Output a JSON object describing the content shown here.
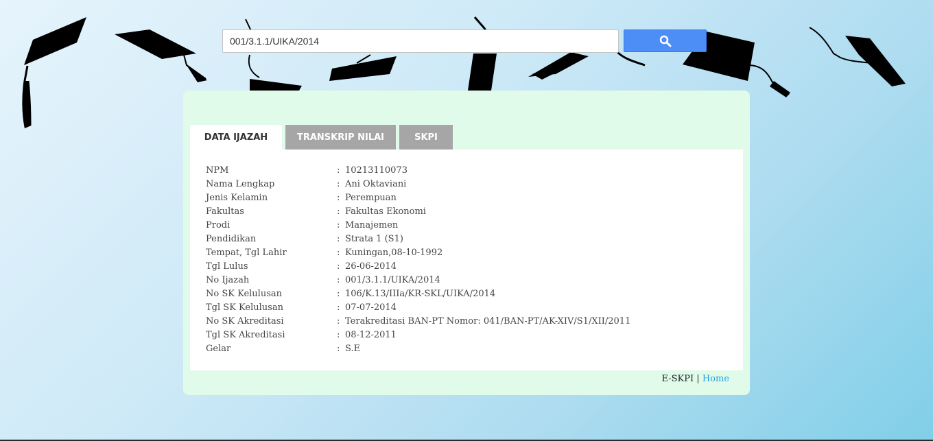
{
  "search": {
    "value": "001/3.1.1/UIKA/2014",
    "button_icon": "search-icon"
  },
  "tabs": [
    {
      "label": "DATA IJAZAH",
      "active": true
    },
    {
      "label": "TRANSKRIP NILAI",
      "active": false
    },
    {
      "label": "SKPI",
      "active": false
    }
  ],
  "separator": ":",
  "fields": [
    {
      "label": "NPM",
      "value": "10213110073"
    },
    {
      "label": "Nama Lengkap",
      "value": "Ani Oktaviani"
    },
    {
      "label": "Jenis Kelamin",
      "value": "Perempuan"
    },
    {
      "label": "Fakultas",
      "value": "Fakultas Ekonomi"
    },
    {
      "label": "Prodi",
      "value": "Manajemen"
    },
    {
      "label": "Pendidikan",
      "value": "Strata 1 (S1)"
    },
    {
      "label": "Tempat, Tgl Lahir",
      "value": "Kuningan,08-10-1992"
    },
    {
      "label": "Tgl Lulus",
      "value": "26-06-2014"
    },
    {
      "label": "No Ijazah",
      "value": "001/3.1.1/UIKA/2014"
    },
    {
      "label": "No SK Kelulusan",
      "value": "106/K.13/IIIa/KR-SKL/UIKA/2014"
    },
    {
      "label": "Tgl SK Kelulusan",
      "value": "07-07-2014"
    },
    {
      "label": "No SK Akreditasi",
      "value": "Terakreditasi BAN-PT Nomor: 041/BAN-PT/AK-XIV/S1/XII/2011"
    },
    {
      "label": "Tgl SK Akreditasi",
      "value": "08-12-2011"
    },
    {
      "label": "Gelar",
      "value": "S.E"
    }
  ],
  "footer": {
    "brand": "E-SKPI",
    "divider": "|",
    "home_link": "Home"
  },
  "colors": {
    "search_button": "#4d8ef6",
    "panel_background": "#e0fbe9",
    "inactive_tab": "#a6a6a6",
    "link": "#2aa0df"
  }
}
